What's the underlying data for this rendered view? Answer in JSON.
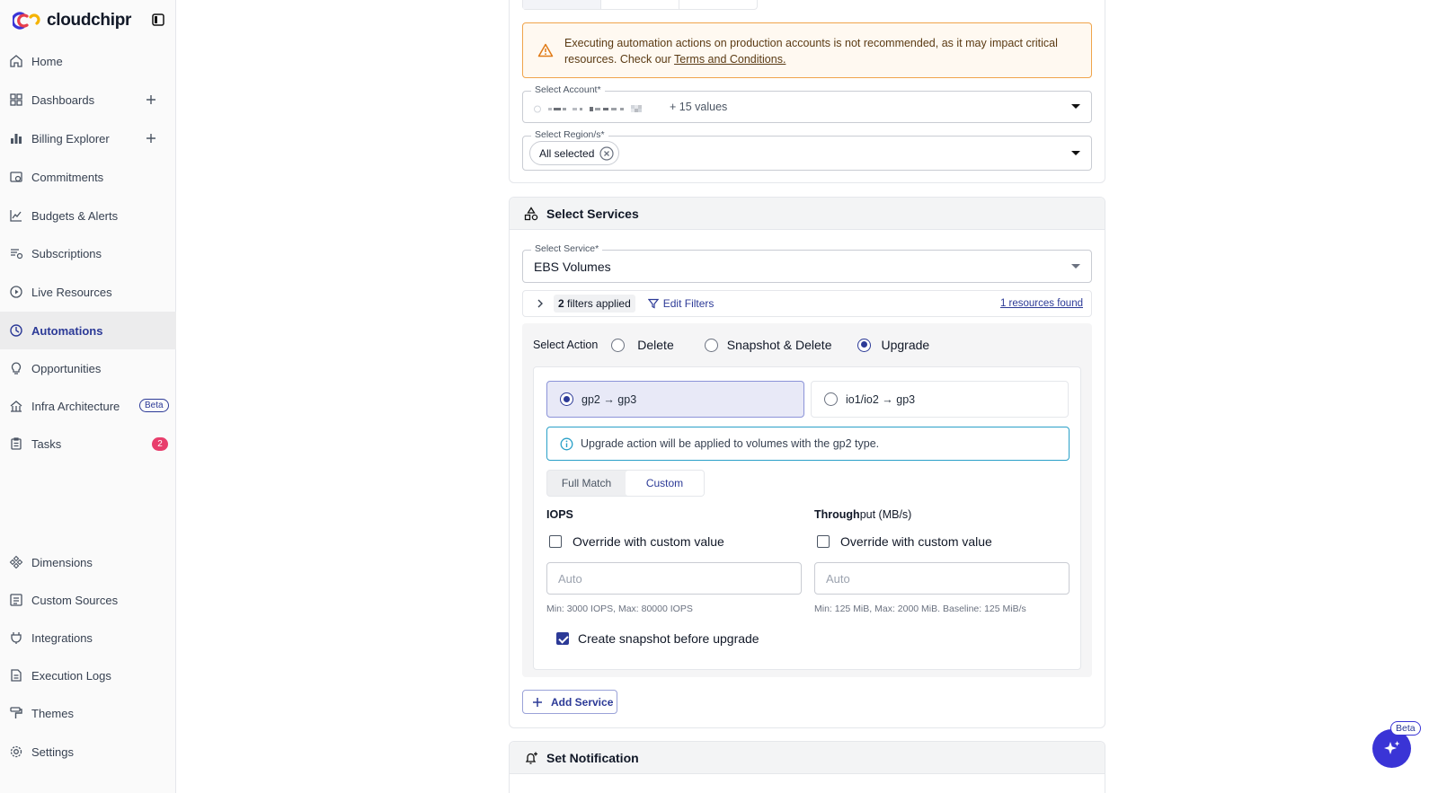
{
  "brand": {
    "name": "cloudchipr"
  },
  "sidebar": {
    "items": [
      {
        "label": "Home"
      },
      {
        "label": "Dashboards"
      },
      {
        "label": "Billing Explorer"
      },
      {
        "label": "Commitments"
      },
      {
        "label": "Budgets & Alerts"
      },
      {
        "label": "Subscriptions"
      },
      {
        "label": "Live Resources"
      },
      {
        "label": "Automations"
      },
      {
        "label": "Opportunities"
      },
      {
        "label": "Infra Architecture",
        "badge": "Beta"
      },
      {
        "label": "Tasks",
        "badge": "2"
      }
    ],
    "bottom_items": [
      {
        "label": "Dimensions"
      },
      {
        "label": "Custom Sources"
      },
      {
        "label": "Integrations"
      },
      {
        "label": "Execution Logs"
      },
      {
        "label": "Themes"
      },
      {
        "label": "Settings"
      }
    ]
  },
  "warning": {
    "text": "Executing automation actions on production accounts is not recommended, as it may impact critical resources. Check our ",
    "link": "Terms and Conditions."
  },
  "account": {
    "label": "Select Account*",
    "more": "+ 15 values"
  },
  "region": {
    "label": "Select Region/s*",
    "chip": "All selected"
  },
  "services": {
    "title": "Select Services",
    "service_label": "Select Service*",
    "service_value": "EBS Volumes",
    "filters_count": "2",
    "filters_text": "filters applied",
    "edit_filters": "Edit Filters",
    "resources_found": "1 resources found",
    "action_label": "Select Action",
    "actions": [
      "Delete",
      "Snapshot & Delete",
      "Upgrade"
    ],
    "upgrade_options": [
      "gp2 → gp3",
      "io1/io2 → gp3"
    ],
    "info": "Upgrade action will be applied to volumes with the gp2 type.",
    "match_modes": [
      "Full Match",
      "Custom"
    ],
    "iops": {
      "title": "IOPS",
      "override": "Override with custom value",
      "placeholder": "Auto",
      "hint": "Min: 3000 IOPS, Max: 80000 IOPS"
    },
    "throughput": {
      "title_bold": "Through",
      "title_rest": "put (MB/s)",
      "override": "Override with custom value",
      "placeholder": "Auto",
      "hint": "Min: 125 MiB, Max: 2000 MiB. Baseline: 125 MiB/s"
    },
    "snapshot": "Create snapshot before upgrade",
    "add_service": "Add Service"
  },
  "notification": {
    "title": "Set Notification"
  },
  "assistant": {
    "badge": "Beta"
  },
  "colors": {
    "accent": "#2c3a97",
    "warning": "#f0a44b",
    "info": "#2aa0c8",
    "fab": "#3a34d6"
  }
}
